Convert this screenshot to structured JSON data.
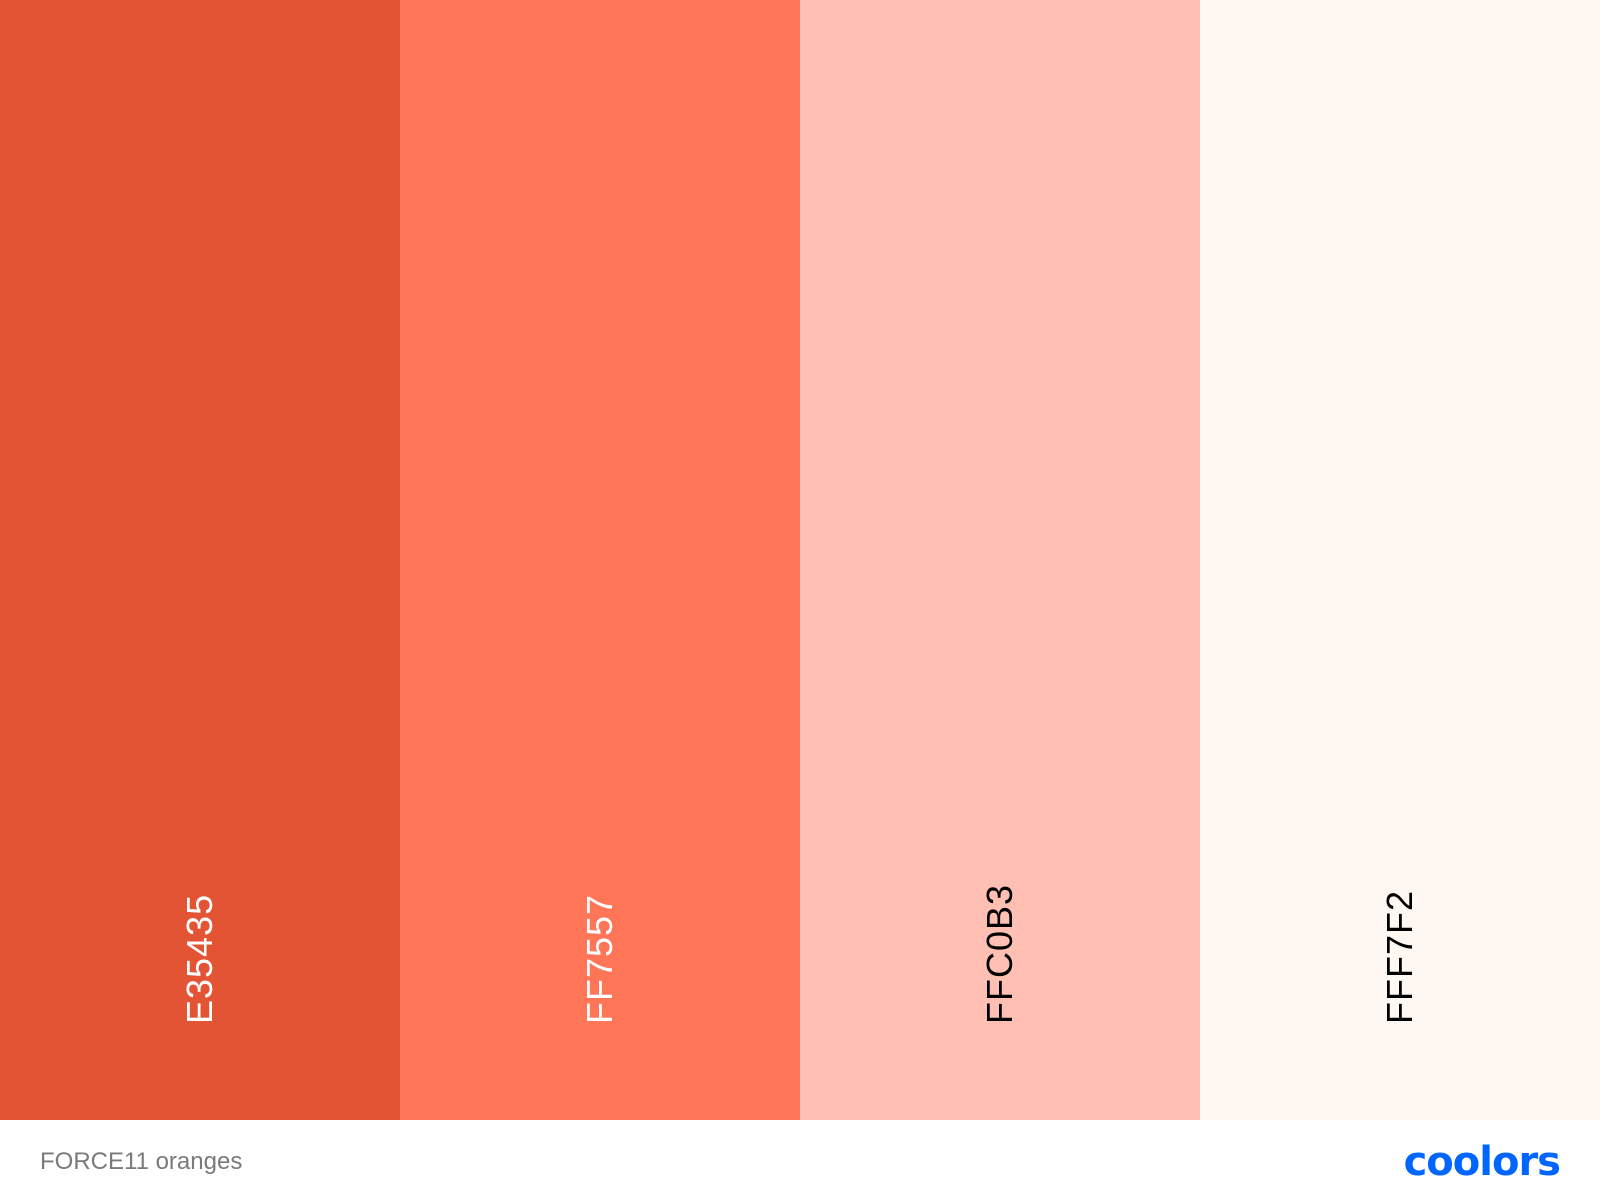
{
  "palette": {
    "swatches": [
      {
        "hex": "E35435",
        "color": "#E35435",
        "label_color": "#ffffff"
      },
      {
        "hex": "FF7557",
        "color": "#FF7557",
        "label_color": "#ffffff"
      },
      {
        "hex": "FFC0B3",
        "color": "#FFC0B3",
        "label_color": "#000000"
      },
      {
        "hex": "FFF7F2",
        "color": "#FFF7F2",
        "label_color": "#000000"
      }
    ]
  },
  "footer": {
    "palette_name": "FORCE11 oranges",
    "logo_text": "coolors",
    "logo_color": "#0066ff"
  }
}
